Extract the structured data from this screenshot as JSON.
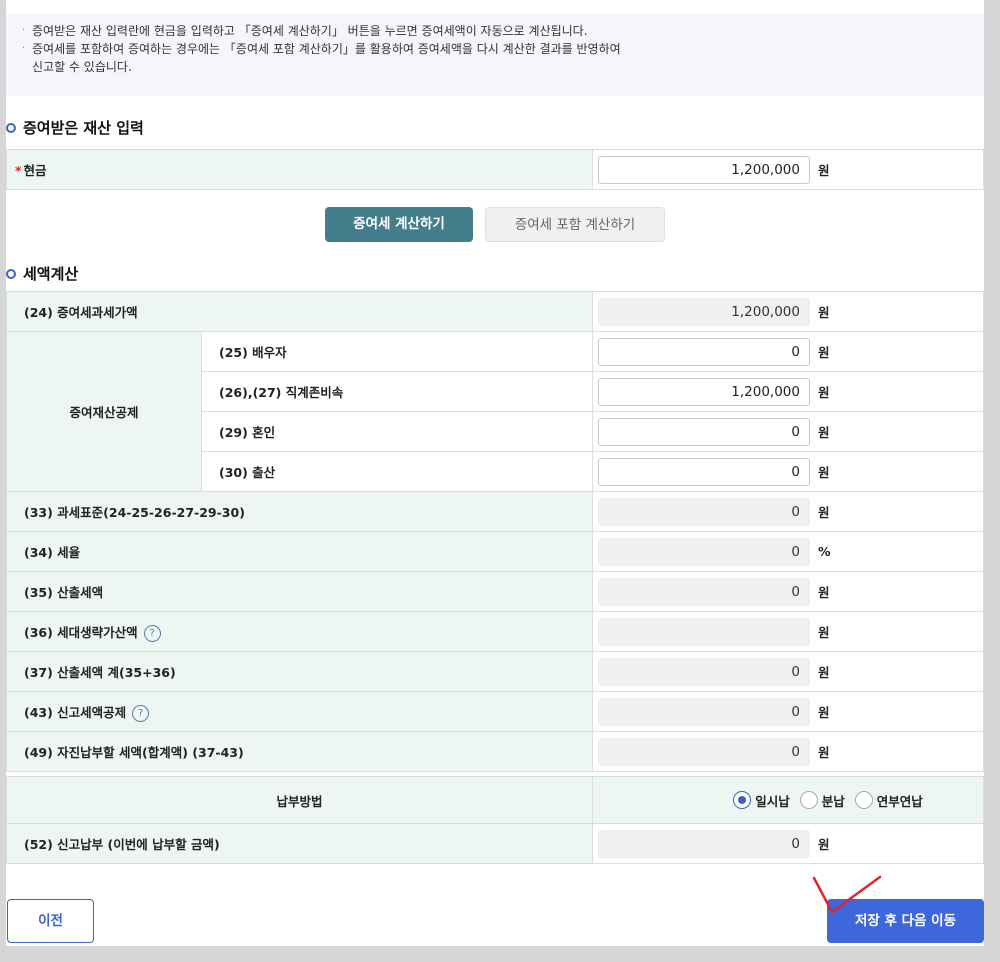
{
  "notice": {
    "line1": "증여받은 재산 입력란에 현금을 입력하고 「증여세 계산하기」 버튼을 누르면 증여세액이 자동으로 계산됩니다.",
    "line2a": "증여세를 포함하여 증여하는 경우에는 「증여세 포함 계산하기」를 활용하여 증여세액을 다시 계산한 결과를 반영하여",
    "line2b": "신고할 수 있습니다.",
    "bullet": "·"
  },
  "input_section": {
    "title": "증여받은 재산 입력",
    "cash_label": "현금",
    "required_mark": "*",
    "cash_value": "1,200,000",
    "unit": "원"
  },
  "buttons": {
    "calc": "증여세 계산하기",
    "calc_incl": "증여세 포함 계산하기"
  },
  "tax_section": {
    "title": "세액계산",
    "taxable_value": {
      "label": "(24) 증여세과세가액",
      "value": "1,200,000",
      "unit": "원"
    },
    "deduction_group": "증여재산공제",
    "spouse": {
      "label": "(25) 배우자",
      "value": "0",
      "unit": "원"
    },
    "lineal": {
      "label": "(26),(27) 직계존비속",
      "value": "1,200,000",
      "unit": "원"
    },
    "marriage": {
      "label": "(29) 혼인",
      "value": "0",
      "unit": "원"
    },
    "birth": {
      "label": "(30) 출산",
      "value": "0",
      "unit": "원"
    },
    "tax_base": {
      "label": "(33) 과세표준(24-25-26-27-29-30)",
      "value": "0",
      "unit": "원"
    },
    "tax_rate": {
      "label": "(34) 세율",
      "value": "0",
      "unit": "%"
    },
    "calc_tax": {
      "label": "(35) 산출세액",
      "value": "0",
      "unit": "원"
    },
    "generation_skip": {
      "label": "(36) 세대생략가산액",
      "value": "",
      "unit": "원"
    },
    "calc_tax_total": {
      "label": "(37) 산출세액 계(35+36)",
      "value": "0",
      "unit": "원"
    },
    "report_deduction": {
      "label": "(43) 신고세액공제",
      "value": "0",
      "unit": "원"
    },
    "self_payment": {
      "label": "(49) 자진납부할 세액(합계액) (37-43)",
      "value": "0",
      "unit": "원"
    },
    "help_mark": "?"
  },
  "payment": {
    "method_label": "납부방법",
    "options": [
      "일시납",
      "분납",
      "연부연납"
    ],
    "selected": "일시납",
    "report_pay": {
      "label": "(52) 신고납부 (이번에 납부할 금액)",
      "value": "0",
      "unit": "원"
    }
  },
  "nav": {
    "prev": "이전",
    "next": "저장 후 다음 이동"
  },
  "colors": {
    "accent": "#3e67dc",
    "calc_button": "#437e8c",
    "label_bg": "#eef6f3",
    "annotation": "#e0262a"
  }
}
